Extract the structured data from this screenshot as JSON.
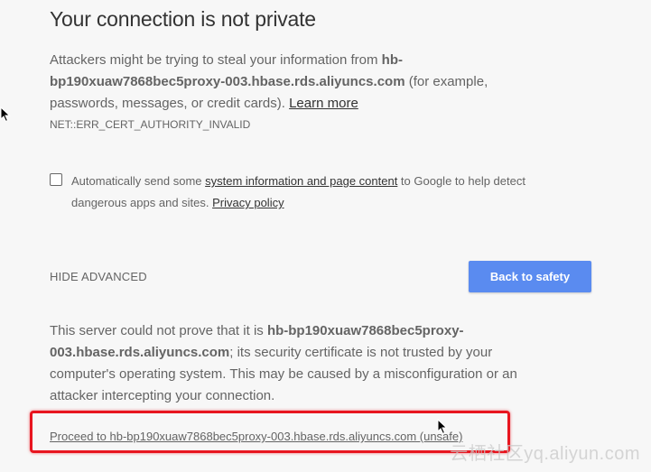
{
  "title": "Your connection is not private",
  "intro": {
    "before": "Attackers might be trying to steal your information from ",
    "host": "hb-bp190xuaw7868bec5proxy-003.hbase.rds.aliyuncs.com",
    "after": " (for example, passwords, messages, or credit cards). ",
    "learn_more": "Learn more"
  },
  "error_code": "NET::ERR_CERT_AUTHORITY_INVALID",
  "report": {
    "checked": false,
    "before": "Automatically send some ",
    "link": "system information and page content",
    "after": " to Google to help detect dangerous apps and sites. ",
    "privacy": "Privacy policy"
  },
  "hide_advanced": "HIDE ADVANCED",
  "back_to_safety": "Back to safety",
  "details": {
    "before": "This server could not prove that it is ",
    "host": "hb-bp190xuaw7868bec5proxy-003.hbase.rds.aliyuncs.com",
    "after": "; its security certificate is not trusted by your computer's operating system. This may be caused by a misconfiguration or an attacker intercepting your connection."
  },
  "proceed_link": "Proceed to hb-bp190xuaw7868bec5proxy-003.hbase.rds.aliyuncs.com (unsafe)",
  "watermark": "云栖社区yq.aliyun.com",
  "colors": {
    "primary_button": "#5a8bf0",
    "highlight": "#e8151f",
    "background": "#f7f7f7"
  }
}
